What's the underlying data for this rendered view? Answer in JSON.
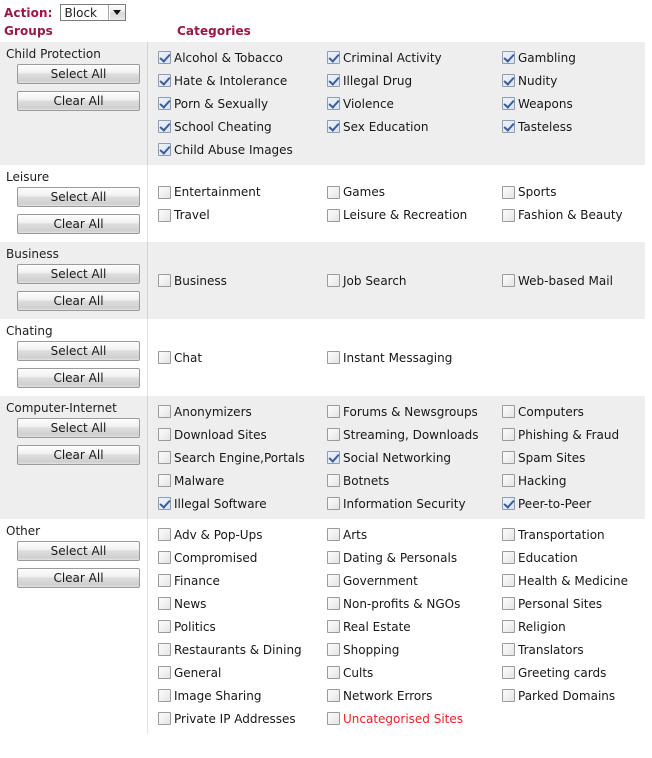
{
  "toolbar": {
    "action_label": "Action:",
    "action_value": "Block",
    "action_options": [
      "Block"
    ]
  },
  "headers": {
    "groups": "Groups",
    "categories": "Categories"
  },
  "buttons": {
    "select_all": "Select All",
    "clear_all": "Clear All"
  },
  "colors": {
    "heading": "#9c1646",
    "alert_text": "#ee2222",
    "row_shaded": "#eeeeee",
    "row_plain": "#ffffff"
  },
  "groups": [
    {
      "name": "Child Protection",
      "shaded": true,
      "rows": [
        [
          {
            "label": "Alcohol & Tobacco",
            "checked": true
          },
          {
            "label": "Criminal Activity",
            "checked": true
          },
          {
            "label": "Gambling",
            "checked": true
          }
        ],
        [
          {
            "label": "Hate & Intolerance",
            "checked": true
          },
          {
            "label": "Illegal Drug",
            "checked": true
          },
          {
            "label": "Nudity",
            "checked": true
          }
        ],
        [
          {
            "label": "Porn & Sexually",
            "checked": true
          },
          {
            "label": "Violence",
            "checked": true
          },
          {
            "label": "Weapons",
            "checked": true
          }
        ],
        [
          {
            "label": "School Cheating",
            "checked": true
          },
          {
            "label": "Sex Education",
            "checked": true
          },
          {
            "label": "Tasteless",
            "checked": true
          }
        ],
        [
          {
            "label": "Child Abuse Images",
            "checked": true
          },
          null,
          null
        ]
      ]
    },
    {
      "name": "Leisure",
      "shaded": false,
      "rows": [
        [
          {
            "label": "Entertainment",
            "checked": false
          },
          {
            "label": "Games",
            "checked": false
          },
          {
            "label": "Sports",
            "checked": false
          }
        ],
        [
          {
            "label": "Travel",
            "checked": false
          },
          {
            "label": "Leisure & Recreation",
            "checked": false
          },
          {
            "label": "Fashion & Beauty",
            "checked": false
          }
        ]
      ]
    },
    {
      "name": "Business",
      "shaded": true,
      "rows": [
        [
          {
            "label": "Business",
            "checked": false
          },
          {
            "label": "Job Search",
            "checked": false
          },
          {
            "label": "Web-based Mail",
            "checked": false
          }
        ]
      ]
    },
    {
      "name": "Chating",
      "shaded": false,
      "rows": [
        [
          {
            "label": "Chat",
            "checked": false
          },
          {
            "label": "Instant Messaging",
            "checked": false
          },
          null
        ]
      ]
    },
    {
      "name": "Computer-Internet",
      "shaded": true,
      "rows": [
        [
          {
            "label": "Anonymizers",
            "checked": false
          },
          {
            "label": "Forums & Newsgroups",
            "checked": false
          },
          {
            "label": "Computers",
            "checked": false
          }
        ],
        [
          {
            "label": "Download Sites",
            "checked": false
          },
          {
            "label": "Streaming, Downloads",
            "checked": false
          },
          {
            "label": "Phishing & Fraud",
            "checked": false
          }
        ],
        [
          {
            "label": "Search Engine,Portals",
            "checked": false
          },
          {
            "label": "Social Networking",
            "checked": true
          },
          {
            "label": "Spam Sites",
            "checked": false
          }
        ],
        [
          {
            "label": "Malware",
            "checked": false
          },
          {
            "label": "Botnets",
            "checked": false
          },
          {
            "label": "Hacking",
            "checked": false
          }
        ],
        [
          {
            "label": "Illegal Software",
            "checked": true
          },
          {
            "label": "Information Security",
            "checked": false
          },
          {
            "label": "Peer-to-Peer",
            "checked": true
          }
        ]
      ]
    },
    {
      "name": "Other",
      "shaded": false,
      "rows": [
        [
          {
            "label": "Adv & Pop-Ups",
            "checked": false
          },
          {
            "label": "Arts",
            "checked": false
          },
          {
            "label": "Transportation",
            "checked": false
          }
        ],
        [
          {
            "label": "Compromised",
            "checked": false
          },
          {
            "label": "Dating & Personals",
            "checked": false
          },
          {
            "label": "Education",
            "checked": false
          }
        ],
        [
          {
            "label": "Finance",
            "checked": false
          },
          {
            "label": "Government",
            "checked": false
          },
          {
            "label": "Health & Medicine",
            "checked": false
          }
        ],
        [
          {
            "label": "News",
            "checked": false
          },
          {
            "label": "Non-profits & NGOs",
            "checked": false
          },
          {
            "label": "Personal Sites",
            "checked": false
          }
        ],
        [
          {
            "label": "Politics",
            "checked": false
          },
          {
            "label": "Real Estate",
            "checked": false
          },
          {
            "label": "Religion",
            "checked": false
          }
        ],
        [
          {
            "label": "Restaurants & Dining",
            "checked": false
          },
          {
            "label": "Shopping",
            "checked": false
          },
          {
            "label": "Translators",
            "checked": false
          }
        ],
        [
          {
            "label": "General",
            "checked": false
          },
          {
            "label": "Cults",
            "checked": false
          },
          {
            "label": "Greeting cards",
            "checked": false
          }
        ],
        [
          {
            "label": "Image Sharing",
            "checked": false
          },
          {
            "label": "Network Errors",
            "checked": false
          },
          {
            "label": "Parked Domains",
            "checked": false
          }
        ],
        [
          {
            "label": "Private IP Addresses",
            "checked": false
          },
          {
            "label": "Uncategorised Sites",
            "checked": false,
            "alert": true
          },
          null
        ]
      ]
    }
  ]
}
